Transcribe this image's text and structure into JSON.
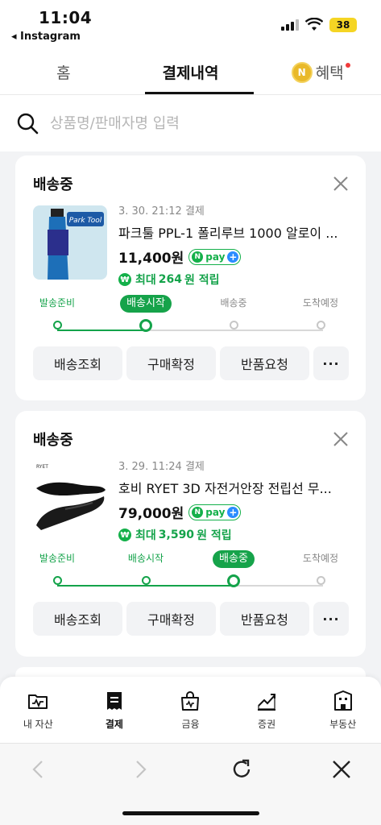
{
  "status_bar": {
    "time": "11:04",
    "back_app": "◂ Instagram",
    "battery": "38"
  },
  "tabs": [
    {
      "label": "홈",
      "active": false
    },
    {
      "label": "결제내역",
      "active": true
    },
    {
      "label": "혜택",
      "active": false,
      "coin": "N"
    }
  ],
  "search": {
    "placeholder": "상품명/판매자명 입력",
    "value": ""
  },
  "npay": {
    "n": "N",
    "pay": "pay",
    "plus": "+"
  },
  "orders": [
    {
      "status": "배송중",
      "date": "3. 30. 21:12 결제",
      "product_name": "파크툴 PPL-1 폴리루브 1000 알로이 ...",
      "price": "11,400원",
      "reward_prefix": "최대",
      "reward_amount": "264",
      "reward_suffix": "원 적립",
      "current_step": 1,
      "image": "Park Tool",
      "buttons": [
        "배송조회",
        "구매확정",
        "반품요청",
        "···"
      ]
    },
    {
      "status": "배송중",
      "date": "3. 29. 11:24 결제",
      "product_name": "호비 RYET 3D 자전거안장 전립선 무...",
      "price": "79,000원",
      "reward_prefix": "최대",
      "reward_amount": "3,590",
      "reward_suffix": "원 적립",
      "current_step": 2,
      "image": "RYET",
      "buttons": [
        "배송조회",
        "구매확정",
        "반품요청",
        "···"
      ]
    }
  ],
  "steps": [
    "발송준비",
    "배송시작",
    "배송중",
    "도착예정"
  ],
  "bottom_nav": [
    {
      "label": "내 자산",
      "icon": "wallet-icon",
      "active": false
    },
    {
      "label": "결제",
      "icon": "receipt-icon",
      "active": true
    },
    {
      "label": "금융",
      "icon": "bag-icon",
      "active": false
    },
    {
      "label": "증권",
      "icon": "chart-icon",
      "active": false
    },
    {
      "label": "부동산",
      "icon": "building-icon",
      "active": false
    }
  ],
  "colors": {
    "accent_green": "#14a34a",
    "npay_blue": "#2a8cff",
    "coin_gold": "#e9b92a"
  }
}
